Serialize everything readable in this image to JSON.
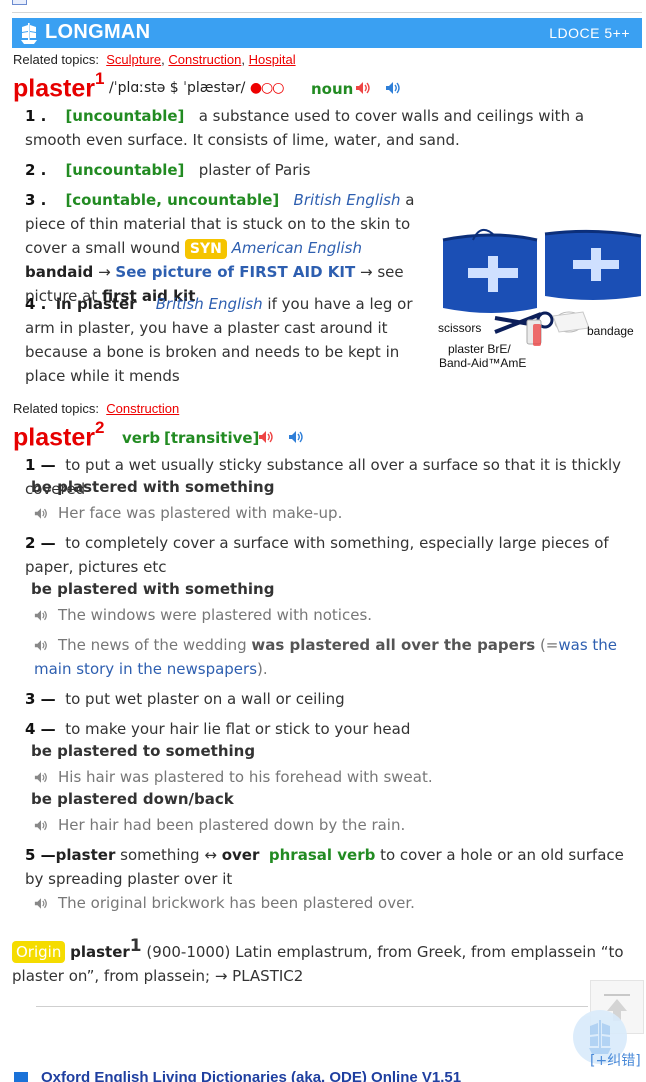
{
  "banner": {
    "brand": "LONGMAN",
    "version": "LDOCE 5++",
    "color": "#3aa0f2"
  },
  "entry1": {
    "topics_label": "Related topics:",
    "topics": [
      "Sculpture",
      "Construction",
      "Hospital"
    ],
    "headword": "plaster",
    "hom": "1",
    "pron": "/ˈplɑːstə $ ˈplæstər/",
    "freq": "●○○",
    "pos": "noun",
    "senses": [
      {
        "num": "1 .",
        "gram": "[uncountable]",
        "def": "a substance used to cover walls and ceilings with a smooth even surface. It consists of lime, water, and sand."
      },
      {
        "num": "2 .",
        "gram": "[uncountable]",
        "def": "plaster of Paris"
      },
      {
        "num": "3 .",
        "gram": "[countable, uncountable]",
        "region": "British English",
        "def": "a piece of thin material that is stuck on to the skin to cover a small wound",
        "syn": "SYN",
        "syn_region": "American English",
        "syn_word": "bandaid",
        "arrow": "→",
        "xref1": "See picture of FIRST AID KIT",
        "xref2_pre": "→ see picture at",
        "xref2": "first aid kit"
      },
      {
        "num": "4 .",
        "lex": "in plaster",
        "region": "British English",
        "def": "if you have a leg or arm in plaster, you have a plaster cast around it because a bone is broken and needs to be kept in place while it mends"
      }
    ],
    "image_labels": {
      "scissors": "scissors",
      "bandage": "bandage",
      "plaster1": "plaster BrE/",
      "plaster2": "Band-Aid™AmE"
    }
  },
  "entry2": {
    "topics_label": "Related topics:",
    "topics": [
      "Construction"
    ],
    "headword": "plaster",
    "hom": "2",
    "pos": "verb",
    "gram": "[transitive]",
    "senses": [
      {
        "num": "1 —",
        "def": "to put a wet usually sticky substance all over a surface so that it is thickly covered",
        "pattern": "be plastered with something",
        "examples": [
          "Her face was plastered with make-up."
        ]
      },
      {
        "num": "2 —",
        "def": "to completely cover a surface with something, especially large pieces of paper, pictures etc",
        "pattern": "be plastered with something",
        "examples": [
          "The windows were plastered with notices."
        ],
        "ex2_pre": "The news of the wedding",
        "ex2_bold": "was plastered all over the papers",
        "ex2_paren_open": "(=",
        "ex2_gloss": "was the main story in the newspapers",
        "ex2_paren_close": ")."
      },
      {
        "num": "3 —",
        "def": "to put wet plaster on a wall or ceiling"
      },
      {
        "num": "4 —",
        "def": "to make your hair lie flat or stick to your head",
        "pattern": "be plastered to something",
        "examples": [
          "His hair was plastered to his forehead with sweat."
        ],
        "pattern2": "be plastered down/back",
        "examples2": [
          "Her hair had been plastered down by the rain."
        ]
      },
      {
        "num": "5 —",
        "pv": "plaster",
        "pv_obj": "something",
        "pv_arrow": "↔",
        "pv_part": "over",
        "pv_label": "phrasal verb",
        "def": "to cover a hole or an old surface by spreading plaster over it",
        "examples": [
          "The original brickwork has been plastered over."
        ]
      }
    ]
  },
  "origin": {
    "tag": "Origin",
    "headword": "plaster",
    "hom": "1",
    "text": "(900-1000) Latin emplastrum, from Greek, from emplassein “to plaster on”, from plassein; → PLASTIC2"
  },
  "footer": {
    "feedback": "[+纠错]",
    "next_dict": "Oxford English Living Dictionaries (aka. ODE) Online V1.51"
  }
}
